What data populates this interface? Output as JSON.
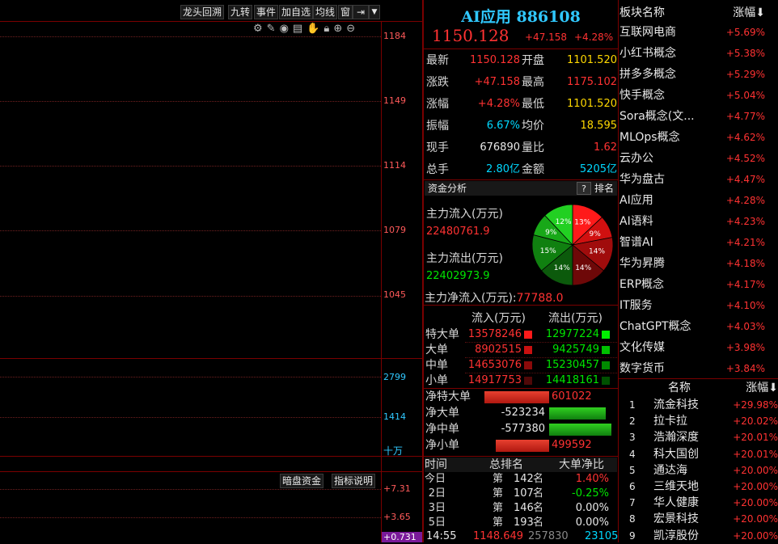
{
  "toolbar": {
    "left_labels": [
      "",
      "",
      "",
      "",
      "",
      "",
      ""
    ],
    "buttons": [
      "龙头回溯",
      "九转",
      "事件",
      "加自选",
      "均线",
      "窗"
    ],
    "icons": [
      "settings-icon",
      "pen-icon",
      "eye-icon",
      "trash-icon",
      "hand-icon",
      "lock-icon",
      "zoom-in-icon",
      "zoom-out-icon"
    ]
  },
  "chart": {
    "price_axis": [
      "1184",
      "1149",
      "1114",
      "1079",
      "1045"
    ],
    "volume_axis": [
      "2799",
      "1414"
    ],
    "volume_unit": "十万",
    "lower_buttons": [
      "暗盘资金",
      "指标说明"
    ],
    "indicator_axis": [
      "+7.31",
      "+3.65",
      "+0.731"
    ]
  },
  "quote": {
    "name": "AI应用",
    "code": "886108",
    "price": "1150.128",
    "change": "+47.158",
    "change_pct": "+4.28%",
    "rows": [
      {
        "l1": "最新",
        "v1": "1150.128",
        "c1": "red",
        "l2": "开盘",
        "v2": "1101.520",
        "c2": "yellow"
      },
      {
        "l1": "涨跌",
        "v1": "+47.158",
        "c1": "red",
        "l2": "最高",
        "v2": "1175.102",
        "c2": "red"
      },
      {
        "l1": "涨幅",
        "v1": "+4.28%",
        "c1": "red",
        "l2": "最低",
        "v2": "1101.520",
        "c2": "yellow"
      },
      {
        "l1": "振幅",
        "v1": "6.67%",
        "c1": "cyan",
        "l2": "均价",
        "v2": "18.595",
        "c2": "yellow"
      },
      {
        "l1": "现手",
        "v1": "676890",
        "c1": "white",
        "l2": "量比",
        "v2": "1.62",
        "c2": "red"
      },
      {
        "l1": "总手",
        "v1": "2.80亿",
        "c1": "cyan",
        "l2": "金额",
        "v2": "5205亿",
        "c2": "cyan"
      }
    ]
  },
  "capital": {
    "title": "资金分析",
    "help": "?",
    "rank_label": "排名",
    "inflow_label": "主力流入(万元)",
    "inflow_value": "22480761.9",
    "outflow_label": "主力流出(万元)",
    "outflow_value": "22402973.9",
    "net_label": "主力净流入(万元):",
    "net_value": "77788.0",
    "pie": [
      {
        "label": "13%",
        "value": 13,
        "color": "#ff1a1a"
      },
      {
        "label": "9%",
        "value": 9,
        "color": "#d01010"
      },
      {
        "label": "14%",
        "value": 14,
        "color": "#a00c0c"
      },
      {
        "label": "14%",
        "value": 14,
        "color": "#6e0808"
      },
      {
        "label": "14%",
        "value": 14,
        "color": "#0c5a0c"
      },
      {
        "label": "15%",
        "value": 15,
        "color": "#108010"
      },
      {
        "label": "9%",
        "value": 9,
        "color": "#18a818"
      },
      {
        "label": "12%",
        "value": 12,
        "color": "#22d022"
      }
    ]
  },
  "flows": {
    "header_in": "流入(万元)",
    "header_out": "流出(万元)",
    "rows": [
      {
        "label": "特大单",
        "in": "13578246",
        "out": "12977224",
        "cin": "#ff1a1a",
        "cout": "#00f000"
      },
      {
        "label": "大单",
        "in": "8902515",
        "out": "9425749",
        "cin": "#c81010",
        "cout": "#00c000"
      },
      {
        "label": "中单",
        "in": "14653076",
        "out": "15230457",
        "cin": "#8a0a0a",
        "cout": "#008a00"
      },
      {
        "label": "小单",
        "in": "14917753",
        "out": "14418161",
        "cin": "#500808",
        "cout": "#005000"
      }
    ]
  },
  "net": {
    "rows": [
      {
        "label": "净特大单",
        "value": "601022",
        "sign": 1,
        "frac": 1.0
      },
      {
        "label": "净大单",
        "value": "-523234",
        "sign": -1,
        "frac": 0.87
      },
      {
        "label": "净中单",
        "value": "-577380",
        "sign": -1,
        "frac": 0.96
      },
      {
        "label": "净小单",
        "value": "499592",
        "sign": 1,
        "frac": 0.83
      }
    ]
  },
  "rank": {
    "headers": [
      "时间",
      "总排名",
      "大单净比"
    ],
    "rows": [
      {
        "day": "今日",
        "pre": "第",
        "rank": "142",
        "suf": "名",
        "ratio": "1.40%",
        "c": "red"
      },
      {
        "day": "2日",
        "pre": "第",
        "rank": "107",
        "suf": "名",
        "ratio": "-0.25%",
        "c": "green"
      },
      {
        "day": "3日",
        "pre": "第",
        "rank": "146",
        "suf": "名",
        "ratio": "0.00%",
        "c": "white"
      },
      {
        "day": "5日",
        "pre": "第",
        "rank": "193",
        "suf": "名",
        "ratio": "0.00%",
        "c": "white"
      }
    ],
    "bottom": {
      "time": "14:55",
      "price": "1148.649",
      "vol": "257830",
      "vol2": "23105"
    }
  },
  "plates": {
    "header_name": "板块名称",
    "header_pct": "涨幅",
    "items": [
      {
        "name": "互联网电商",
        "pct": "+5.69%"
      },
      {
        "name": "小红书概念",
        "pct": "+5.38%"
      },
      {
        "name": "拼多多概念",
        "pct": "+5.29%"
      },
      {
        "name": "快手概念",
        "pct": "+5.04%"
      },
      {
        "name": "Sora概念(文...",
        "pct": "+4.77%"
      },
      {
        "name": "MLOps概念",
        "pct": "+4.62%"
      },
      {
        "name": "云办公",
        "pct": "+4.52%"
      },
      {
        "name": "华为盘古",
        "pct": "+4.47%"
      },
      {
        "name": "AI应用",
        "pct": "+4.28%"
      },
      {
        "name": "AI语料",
        "pct": "+4.23%"
      },
      {
        "name": "智谱AI",
        "pct": "+4.21%"
      },
      {
        "name": "华为昇腾",
        "pct": "+4.18%"
      },
      {
        "name": "ERP概念",
        "pct": "+4.17%"
      },
      {
        "name": "IT服务",
        "pct": "+4.10%"
      },
      {
        "name": "ChatGPT概念",
        "pct": "+4.03%"
      },
      {
        "name": "文化传媒",
        "pct": "+3.98%"
      },
      {
        "name": "数字货币",
        "pct": "+3.84%"
      }
    ]
  },
  "stocks": {
    "header_name": "名称",
    "header_pct": "涨幅",
    "items": [
      {
        "i": "1",
        "name": "流金科技",
        "pct": "+29.98%"
      },
      {
        "i": "2",
        "name": "拉卡拉",
        "pct": "+20.02%"
      },
      {
        "i": "3",
        "name": "浩瀚深度",
        "pct": "+20.01%"
      },
      {
        "i": "4",
        "name": "科大国创",
        "pct": "+20.01%"
      },
      {
        "i": "5",
        "name": "通达海",
        "pct": "+20.00%"
      },
      {
        "i": "6",
        "name": "三维天地",
        "pct": "+20.00%"
      },
      {
        "i": "7",
        "name": "华人健康",
        "pct": "+20.00%"
      },
      {
        "i": "8",
        "name": "宏景科技",
        "pct": "+20.00%"
      },
      {
        "i": "9",
        "name": "凯淳股份",
        "pct": "+20.00%"
      }
    ]
  }
}
